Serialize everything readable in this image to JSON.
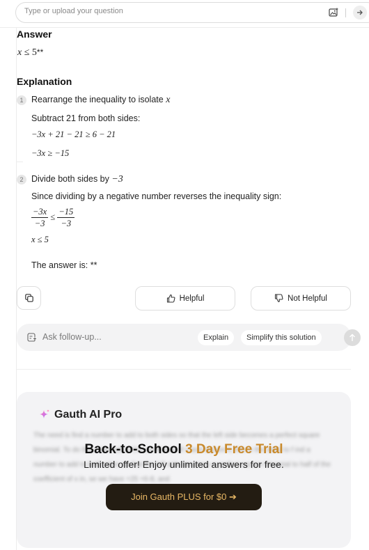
{
  "search": {
    "placeholder": "Type or upload your question"
  },
  "answer": {
    "heading": "Answer",
    "result_suffix": "**"
  },
  "explanation": {
    "heading": "Explanation",
    "steps": [
      {
        "number": "1",
        "title": "Rearrange the inequality to isolate",
        "variable": "x",
        "note": "Subtract 21 from both sides:",
        "eq1": "−3x + 21 − 21 ≥ 6 − 21",
        "eq2": "−3x ≥ −15"
      },
      {
        "number": "2",
        "title": "Divide both sides by",
        "divisor": "−3",
        "note": "Since dividing by a negative number reverses the inequality sign:",
        "frac_left_num": "−3x",
        "frac_left_den": "−3",
        "relation": "≤",
        "frac_right_num": "−15",
        "frac_right_den": "−3",
        "eq_result": "x ≤ 5"
      }
    ],
    "final": "The answer is: **"
  },
  "feedback": {
    "helpful": "Helpful",
    "not_helpful": "Not Helpful"
  },
  "followup": {
    "placeholder": "Ask follow-up...",
    "chips": [
      "Explain",
      "Simplify this solution"
    ]
  },
  "pro": {
    "title": "Gauth AI Pro",
    "blurred_text": "The need is find a number to add to both sides so that the left side becomes a perfect square binomial. To do this, take half of the coefficient of x and square it, this is the need to f ind a number to add to both sides so that the left side becomes a perfect square binomial to half of the coefficient of x in, se we have +25 +6-8, and",
    "headline_main": "Back-to-School ",
    "headline_accent": "3 Day Free Trial",
    "offer": "Limited offer! Enjoy unlimited answers for free.",
    "cta": "Join Gauth PLUS for $0 ➔"
  },
  "colors": {
    "accent": "#c98a2c",
    "cta_bg": "#231c12",
    "cta_text": "#e9b865"
  }
}
